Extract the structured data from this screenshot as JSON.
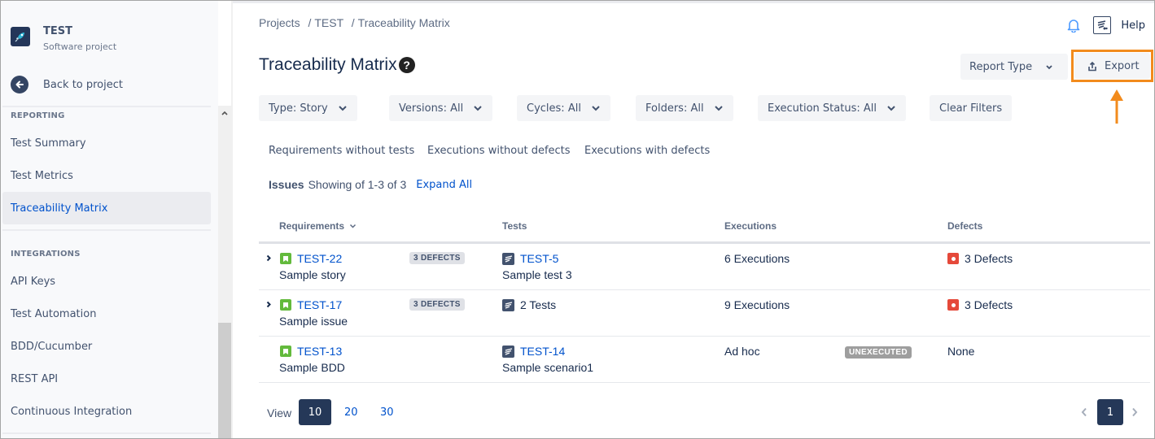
{
  "sidebar": {
    "project_name": "TEST",
    "project_type": "Software project",
    "back_label": "Back to project",
    "sections": [
      {
        "title": "REPORTING",
        "items": [
          {
            "label": "Test Summary",
            "active": false
          },
          {
            "label": "Test Metrics",
            "active": false
          },
          {
            "label": "Traceability Matrix",
            "active": true
          }
        ]
      },
      {
        "title": "INTEGRATIONS",
        "items": [
          {
            "label": "API Keys",
            "active": false
          },
          {
            "label": "Test Automation",
            "active": false
          },
          {
            "label": "BDD/Cucumber",
            "active": false
          },
          {
            "label": "REST API",
            "active": false
          },
          {
            "label": "Continuous Integration",
            "active": false
          }
        ]
      }
    ]
  },
  "header": {
    "breadcrumb": [
      "Projects",
      "TEST",
      "Traceability Matrix"
    ],
    "breadcrumb_sep": "/",
    "help_label": "Help",
    "title": "Traceability Matrix",
    "help_icon_glyph": "?",
    "report_type_label": "Report Type",
    "export_label": "Export"
  },
  "filters": {
    "items": [
      "Type: Story",
      "Versions: All",
      "Cycles: All",
      "Folders: All",
      "Execution Status: All"
    ],
    "clear_label": "Clear Filters"
  },
  "quick_links": [
    "Requirements without tests",
    "Executions without defects",
    "Executions with defects"
  ],
  "issues": {
    "label": "Issues",
    "showing": "Showing of 1-3 of 3",
    "expand_all": "Expand All"
  },
  "table": {
    "columns": [
      "Requirements",
      "Tests",
      "Executions",
      "Defects"
    ],
    "rows": [
      {
        "expandable": true,
        "req_key": "TEST-22",
        "req_summary": "Sample story",
        "req_badge": "3 DEFECTS",
        "test_label": "TEST-5",
        "test_is_link": true,
        "test_summary": "Sample test 3",
        "executions": "6 Executions",
        "exec_badge": "",
        "defects": "3 Defects",
        "has_defects": true
      },
      {
        "expandable": true,
        "req_key": "TEST-17",
        "req_summary": "Sample issue",
        "req_badge": "3 DEFECTS",
        "test_label": "2 Tests",
        "test_is_link": false,
        "test_summary": "",
        "executions": "9 Executions",
        "exec_badge": "",
        "defects": "3 Defects",
        "has_defects": true
      },
      {
        "expandable": false,
        "req_key": "TEST-13",
        "req_summary": "Sample BDD",
        "req_badge": "",
        "test_label": "TEST-14",
        "test_is_link": true,
        "test_summary": "Sample scenario1",
        "executions": "Ad hoc",
        "exec_badge": "UNEXECUTED",
        "defects": "None",
        "has_defects": false
      }
    ]
  },
  "pagination": {
    "view_label": "View",
    "page_sizes": [
      "10",
      "20",
      "30"
    ],
    "active_size": "10",
    "current_page": "1"
  },
  "colors": {
    "accent": "#0052cc",
    "highlight": "#f28b1d",
    "story": "#63ba3c",
    "bug": "#e5493a",
    "active_dark": "#253858"
  }
}
